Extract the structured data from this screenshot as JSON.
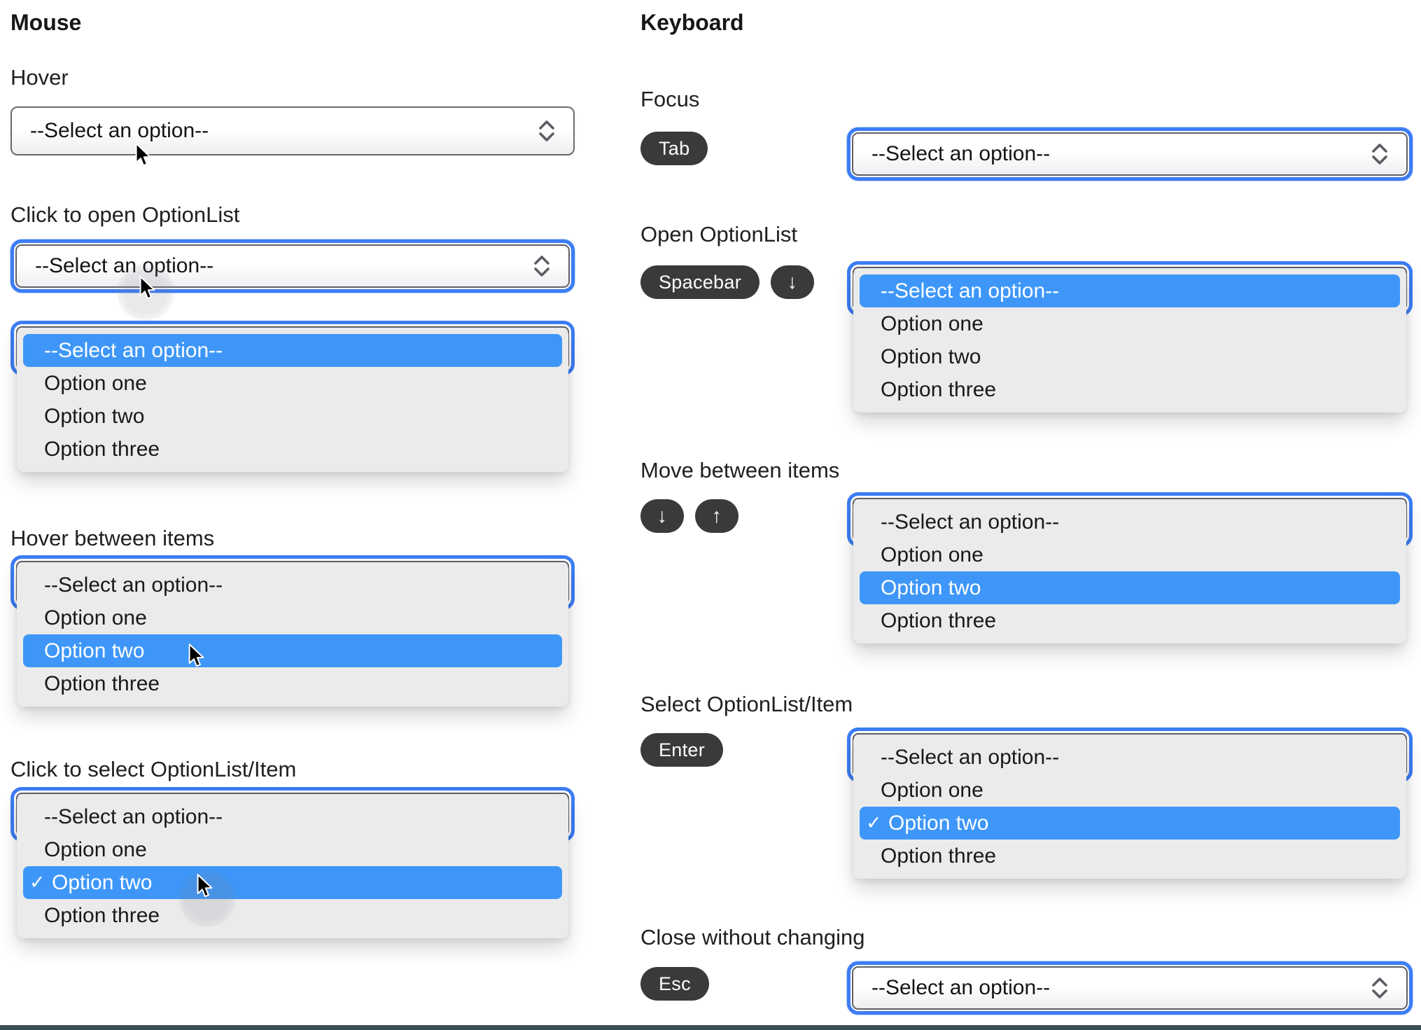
{
  "titles": {
    "mouse": "Mouse",
    "keyboard": "Keyboard"
  },
  "mouse_sections": {
    "hover": "Hover",
    "click_open": "Click to open OptionList",
    "hover_items": "Hover between items",
    "click_select": "Click to select OptionList/Item"
  },
  "keyboard_sections": {
    "focus": "Focus",
    "open": "Open OptionList",
    "move": "Move between items",
    "select": "Select OptionList/Item",
    "close": "Close without changing"
  },
  "select": {
    "placeholder": "--Select an option--"
  },
  "options": [
    {
      "label": "--Select an option--"
    },
    {
      "label": "Option one"
    },
    {
      "label": "Option two"
    },
    {
      "label": "Option three"
    }
  ],
  "keys": {
    "tab": "Tab",
    "spacebar": "Spacebar",
    "down": "↓",
    "up": "↑",
    "enter": "Enter",
    "esc": "Esc"
  },
  "glyphs": {
    "check": "✓"
  },
  "colors": {
    "focus_ring": "#3c7df3",
    "selection_blue": "#3e97f8",
    "panel_background": "#ebebec",
    "key_badge": "#3a3a3c",
    "bottom_divider": "#3c4d57"
  }
}
